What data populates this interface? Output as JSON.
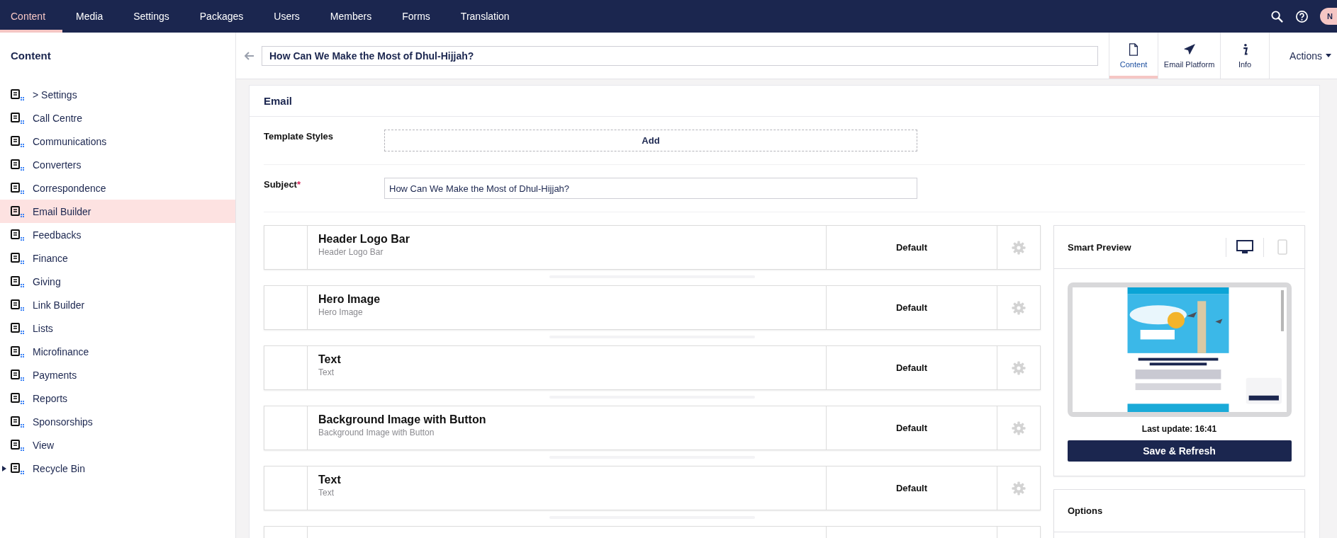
{
  "top_nav": {
    "tabs": [
      {
        "label": "Content",
        "selected": true
      },
      {
        "label": "Media",
        "selected": false
      },
      {
        "label": "Settings",
        "selected": false
      },
      {
        "label": "Packages",
        "selected": false
      },
      {
        "label": "Users",
        "selected": false
      },
      {
        "label": "Members",
        "selected": false
      },
      {
        "label": "Forms",
        "selected": false
      },
      {
        "label": "Translation",
        "selected": false
      }
    ],
    "avatar": "N"
  },
  "sidebar": {
    "title": "Content",
    "items": [
      {
        "label": "> Settings",
        "selected": false,
        "expandable": false
      },
      {
        "label": "Call Centre",
        "selected": false,
        "expandable": false
      },
      {
        "label": "Communications",
        "selected": false,
        "expandable": false
      },
      {
        "label": "Converters",
        "selected": false,
        "expandable": false
      },
      {
        "label": "Correspondence",
        "selected": false,
        "expandable": false
      },
      {
        "label": "Email Builder",
        "selected": true,
        "expandable": false
      },
      {
        "label": "Feedbacks",
        "selected": false,
        "expandable": false
      },
      {
        "label": "Finance",
        "selected": false,
        "expandable": false
      },
      {
        "label": "Giving",
        "selected": false,
        "expandable": false
      },
      {
        "label": "Link Builder",
        "selected": false,
        "expandable": false
      },
      {
        "label": "Lists",
        "selected": false,
        "expandable": false
      },
      {
        "label": "Microfinance",
        "selected": false,
        "expandable": false
      },
      {
        "label": "Payments",
        "selected": false,
        "expandable": false
      },
      {
        "label": "Reports",
        "selected": false,
        "expandable": false
      },
      {
        "label": "Sponsorships",
        "selected": false,
        "expandable": false
      },
      {
        "label": "View",
        "selected": false,
        "expandable": false
      },
      {
        "label": "Recycle Bin",
        "selected": false,
        "expandable": true
      }
    ]
  },
  "editor": {
    "name": "How Can We Make the Most of Dhul-Hijjah?",
    "apps": [
      {
        "kind": "document",
        "label": "Content",
        "selected": true
      },
      {
        "kind": "send",
        "label": "Email Platform",
        "selected": false
      },
      {
        "kind": "info",
        "label": "Info",
        "selected": false
      }
    ],
    "actions": "Actions"
  },
  "email": {
    "title": "Email",
    "template_styles": {
      "label": "Template Styles",
      "button": "Add"
    },
    "subject": {
      "label": "Subject",
      "required_mark": "*",
      "value": "How Can We Make the Most of Dhul-Hijjah?"
    },
    "blocks": [
      {
        "title": "Header Logo Bar",
        "subtitle": "Header Logo Bar",
        "style": "Default"
      },
      {
        "title": "Hero Image",
        "subtitle": "Hero Image",
        "style": "Default"
      },
      {
        "title": "Text",
        "subtitle": "Text",
        "style": "Default"
      },
      {
        "title": "Background Image with Button",
        "subtitle": "Background Image with Button",
        "style": "Default"
      },
      {
        "title": "Text",
        "subtitle": "Text",
        "style": "Default"
      }
    ]
  },
  "smart_preview": {
    "title": "Smart Preview",
    "devices": [
      {
        "kind": "desktop",
        "selected": true
      },
      {
        "kind": "mobile",
        "selected": false
      }
    ],
    "last_update": "Last update: 16:41",
    "button": "Save & Refresh"
  },
  "options": {
    "title": "Options"
  }
}
